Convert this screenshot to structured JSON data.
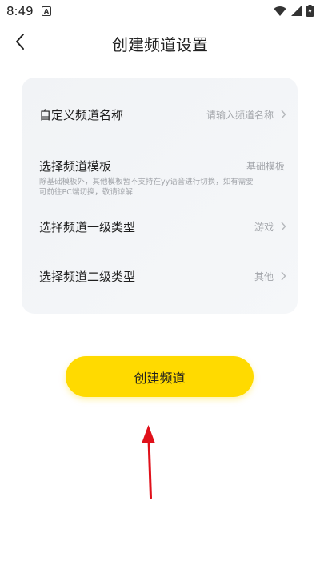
{
  "status_bar": {
    "time": "8:49",
    "notif_letter": "A"
  },
  "nav": {
    "title": "创建频道设置"
  },
  "form": {
    "name_row": {
      "label": "自定义频道名称",
      "placeholder": "请输入频道名称"
    },
    "template_row": {
      "label": "选择频道模板",
      "value": "基础模板",
      "note_line1": "除基础模板外，其他模板暂不支持在yy语音进行切换，如有需要",
      "note_line2": "可前往PC端切换，敬请谅解"
    },
    "category1_row": {
      "label": "选择频道一级类型",
      "value": "游戏"
    },
    "category2_row": {
      "label": "选择频道二级类型",
      "value": "其他"
    }
  },
  "action": {
    "create_label": "创建频道",
    "button_color": "#ffda00"
  },
  "annotation": {
    "arrow_color": "#e0101a"
  }
}
